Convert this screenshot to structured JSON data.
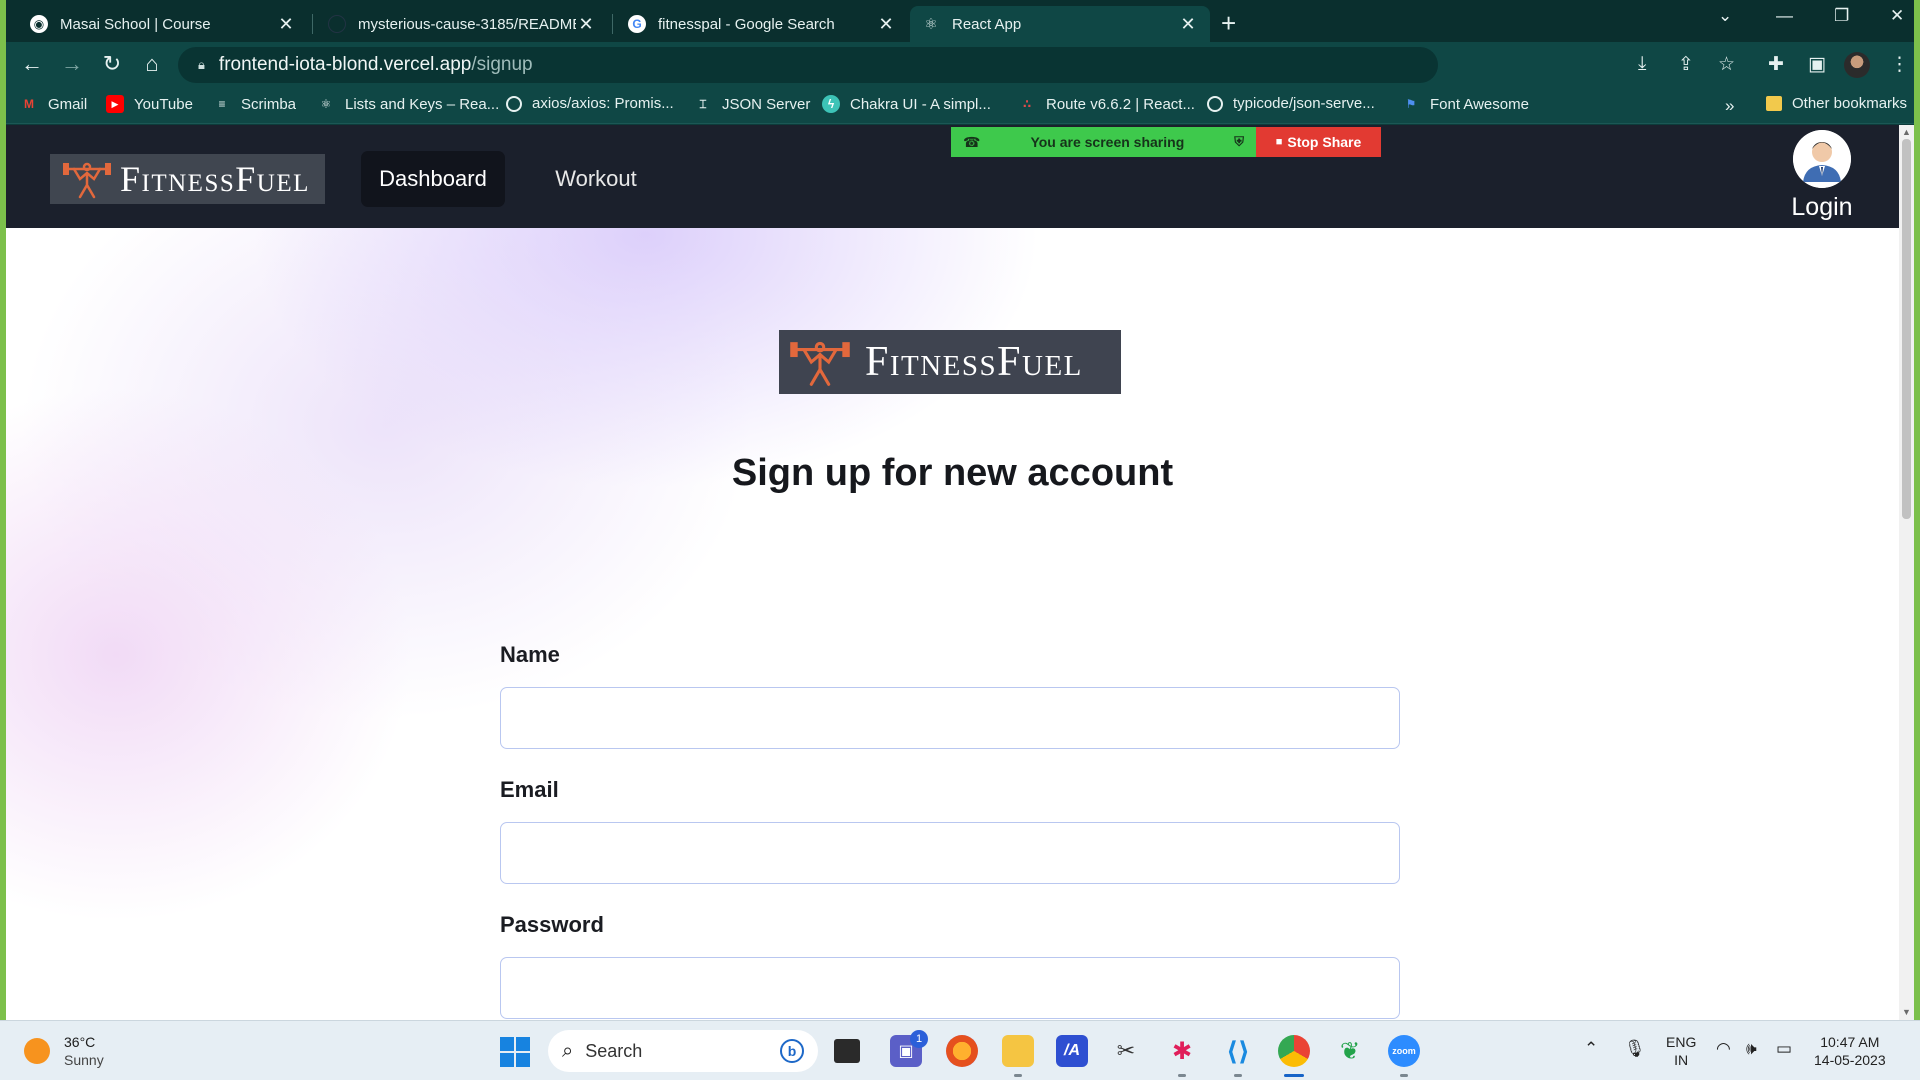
{
  "browser": {
    "tabs": [
      {
        "title": "Masai School | Course",
        "icon": "masai-icon"
      },
      {
        "title": "mysterious-cause-3185/README.md",
        "icon": "github-icon"
      },
      {
        "title": "fitnesspal - Google Search",
        "icon": "google-icon"
      },
      {
        "title": "React App",
        "icon": "react-icon",
        "active": true
      }
    ],
    "url_host": "frontend-iota-blond.vercel.app",
    "url_path": "/signup",
    "bookmarks": [
      {
        "label": "Gmail",
        "icon": "gmail-icon"
      },
      {
        "label": "YouTube",
        "icon": "youtube-icon"
      },
      {
        "label": "Scrimba",
        "icon": "scrimba-icon"
      },
      {
        "label": "Lists and Keys – Rea...",
        "icon": "react-icon"
      },
      {
        "label": "axios/axios: Promis...",
        "icon": "github-icon"
      },
      {
        "label": "JSON Server",
        "icon": "json-server-icon"
      },
      {
        "label": "Chakra UI - A simpl...",
        "icon": "chakra-icon"
      },
      {
        "label": "Route v6.6.2 | React...",
        "icon": "react-router-icon"
      },
      {
        "label": "typicode/json-serve...",
        "icon": "github-icon"
      },
      {
        "label": "Font Awesome",
        "icon": "font-awesome-icon"
      }
    ],
    "other_bookmarks": "Other bookmarks",
    "colors": {
      "frame": "#0d3b3a",
      "desktop_border": "#7cc04b"
    }
  },
  "site": {
    "logo_text": "FitnessFuel",
    "nav": {
      "dashboard": "Dashboard",
      "workout": "Workout",
      "login": "Login"
    },
    "screen_share": {
      "status": "You are screen sharing",
      "stop": "Stop Share"
    },
    "title": "Sign up for new account",
    "form": {
      "name_label": "Name",
      "name_value": "",
      "email_label": "Email",
      "email_value": "",
      "password_label": "Password",
      "password_value": ""
    },
    "colors": {
      "nav_bg": "#1b202c",
      "logo_accent": "#e2683c",
      "share_green": "#3ec94c",
      "share_red": "#e23a32"
    }
  },
  "taskbar": {
    "weather_temp": "36°C",
    "weather_cond": "Sunny",
    "search_placeholder": "Search",
    "teams_badge": "1",
    "lang_primary": "ENG",
    "lang_region": "IN",
    "time": "10:47 AM",
    "date": "14-05-2023"
  }
}
